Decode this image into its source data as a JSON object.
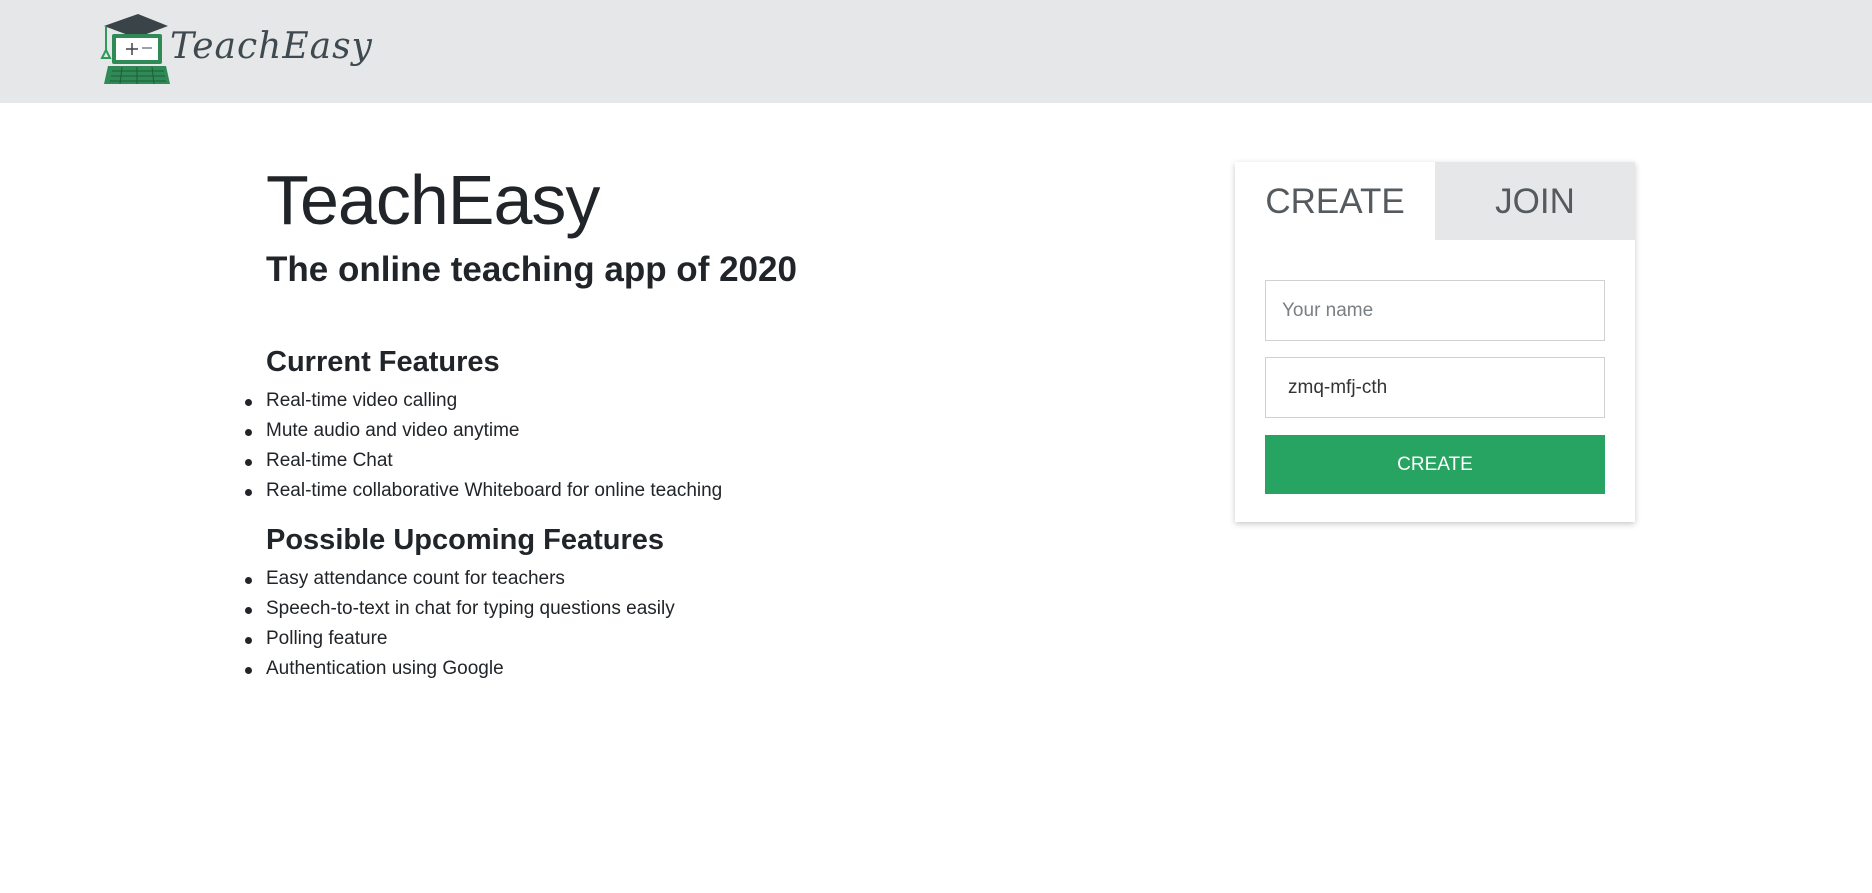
{
  "header": {
    "logo_text": "TeachEasy",
    "logo_icon": "graduation-laptop-icon",
    "background_color": "#e6e7e8"
  },
  "hero": {
    "title": "TeachEasy",
    "subtitle": "The online teaching app of 2020"
  },
  "current_features": {
    "heading": "Current Features",
    "items": [
      "Real-time video calling",
      "Mute audio and video anytime",
      "Real-time Chat",
      "Real-time collaborative Whiteboard for online teaching"
    ]
  },
  "upcoming_features": {
    "heading": "Possible Upcoming Features",
    "items": [
      "Easy attendance count for teachers",
      "Speech-to-text in chat for typing questions easily",
      "Polling feature",
      "Authentication using Google"
    ]
  },
  "panel": {
    "tabs": [
      {
        "label": "CREATE",
        "active": true
      },
      {
        "label": "JOIN",
        "active": false
      }
    ],
    "name_field": {
      "placeholder": "Your name",
      "value": ""
    },
    "code_field": {
      "placeholder": "",
      "value": "zmq-mfj-cth"
    },
    "submit_label": "CREATE",
    "accent_color": "#28a462"
  }
}
